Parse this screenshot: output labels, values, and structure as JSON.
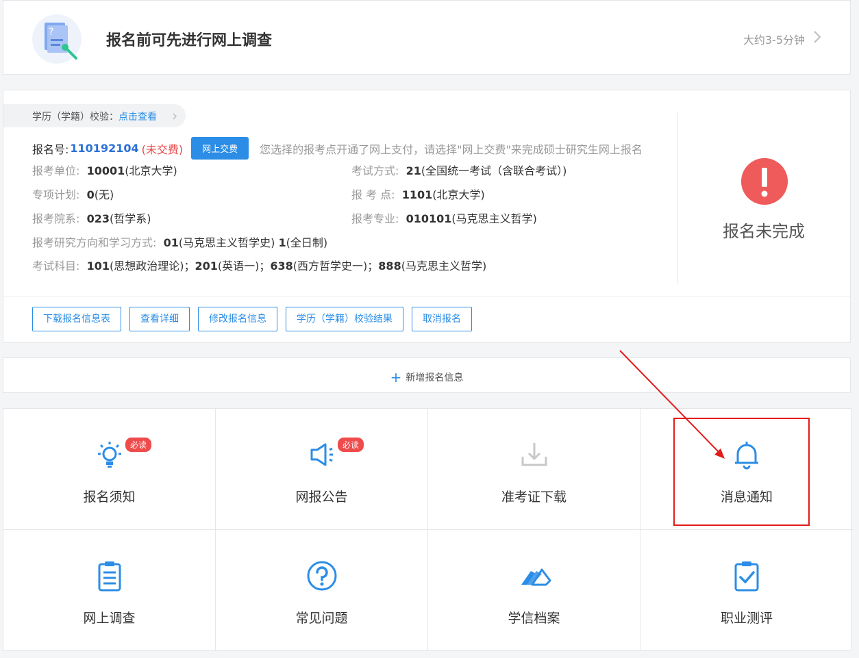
{
  "survey": {
    "title": "报名前可先进行网上调查",
    "time": "大约3-5分钟"
  },
  "registration": {
    "verify_label": "学历（学籍）校验：",
    "verify_link": "点击查看",
    "reg_no_label": "报名号:",
    "reg_no": "110192104",
    "unpaid": "(未交费)",
    "pay_button": "网上交费",
    "pay_note": "您选择的报考点开通了网上支付，请选择\"网上交费\"来完成硕士研究生网上报名",
    "fields": {
      "unit_label": "报考单位:",
      "unit_code": "10001",
      "unit_name": "(北京大学)",
      "mode_label": "考试方式:",
      "mode_code": "21",
      "mode_name": "(全国统一考试（含联合考试）)",
      "plan_label": "专项计划:",
      "plan_code": "0",
      "plan_name": "(无)",
      "site_label": "报 考 点:",
      "site_code": "1101",
      "site_name": "(北京大学)",
      "dept_label": "报考院系:",
      "dept_code": "023",
      "dept_name": "(哲学系)",
      "major_label": "报考专业:",
      "major_code": "010101",
      "major_name": "(马克思主义哲学)",
      "direction_label": "报考研究方向和学习方式:",
      "direction_code": "01",
      "direction_name": "(马克思主义哲学史)",
      "study_code": "1",
      "study_name": "(全日制)",
      "subjects_label": "考试科目:",
      "s1_code": "101",
      "s1_name": "(思想政治理论)；",
      "s2_code": "201",
      "s2_name": "(英语一)；",
      "s3_code": "638",
      "s3_name": "(西方哲学史一)；",
      "s4_code": "888",
      "s4_name": "(马克思主义哲学)"
    },
    "status": "报名未完成",
    "buttons": [
      "下载报名信息表",
      "查看详细",
      "修改报名信息",
      "学历（学籍）校验结果",
      "取消报名"
    ]
  },
  "add_registration": "新增报名信息",
  "tiles": [
    {
      "label": "报名须知",
      "icon": "lightbulb-icon",
      "badge": "必读"
    },
    {
      "label": "网报公告",
      "icon": "megaphone-icon",
      "badge": "必读"
    },
    {
      "label": "准考证下载",
      "icon": "download-tray-icon",
      "badge": ""
    },
    {
      "label": "消息通知",
      "icon": "bell-icon",
      "badge": ""
    },
    {
      "label": "网上调查",
      "icon": "clipboard-list-icon",
      "badge": ""
    },
    {
      "label": "常见问题",
      "icon": "question-circle-icon",
      "badge": ""
    },
    {
      "label": "学信档案",
      "icon": "archive-cards-icon",
      "badge": ""
    },
    {
      "label": "职业测评",
      "icon": "clipboard-check-icon",
      "badge": ""
    }
  ],
  "colors": {
    "accent": "#2b8de6",
    "danger": "#ef5b5b",
    "annotation": "#e31b1b",
    "disabled_icon": "#c8c8c8"
  }
}
